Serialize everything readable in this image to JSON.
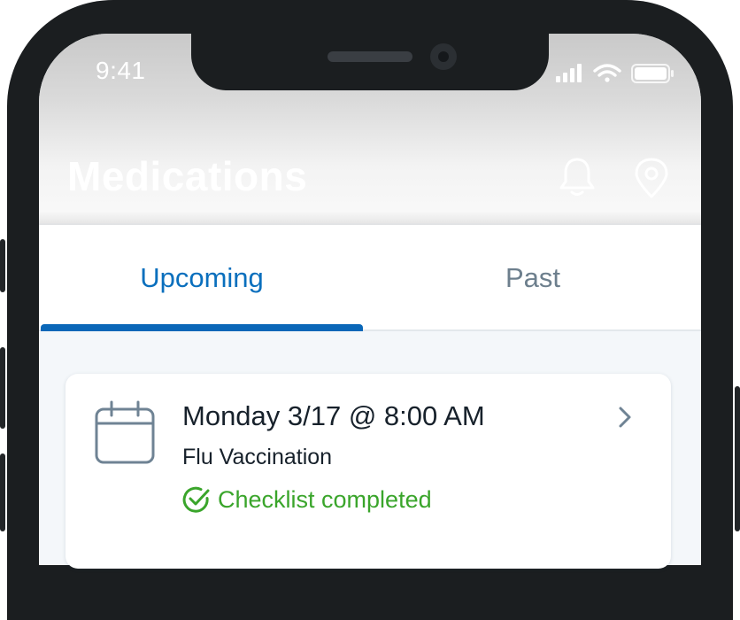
{
  "status_bar": {
    "time": "9:41"
  },
  "header": {
    "title": "Medications",
    "icons": [
      "bell-icon",
      "location-pin-icon"
    ]
  },
  "tabs": [
    {
      "label": "Upcoming",
      "selected": true
    },
    {
      "label": "Past",
      "selected": false
    }
  ],
  "appointments": [
    {
      "date": "Monday 3/17 @ 8:00 AM",
      "title": "Flu Vaccination",
      "status": "Checklist completed",
      "icon": "calendar-icon"
    }
  ],
  "colors": {
    "accent": "#0a67b8",
    "tab_inactive": "#6d7f8d",
    "success": "#3aa52b",
    "text": "#17212b",
    "background": "#f4f7fa"
  }
}
